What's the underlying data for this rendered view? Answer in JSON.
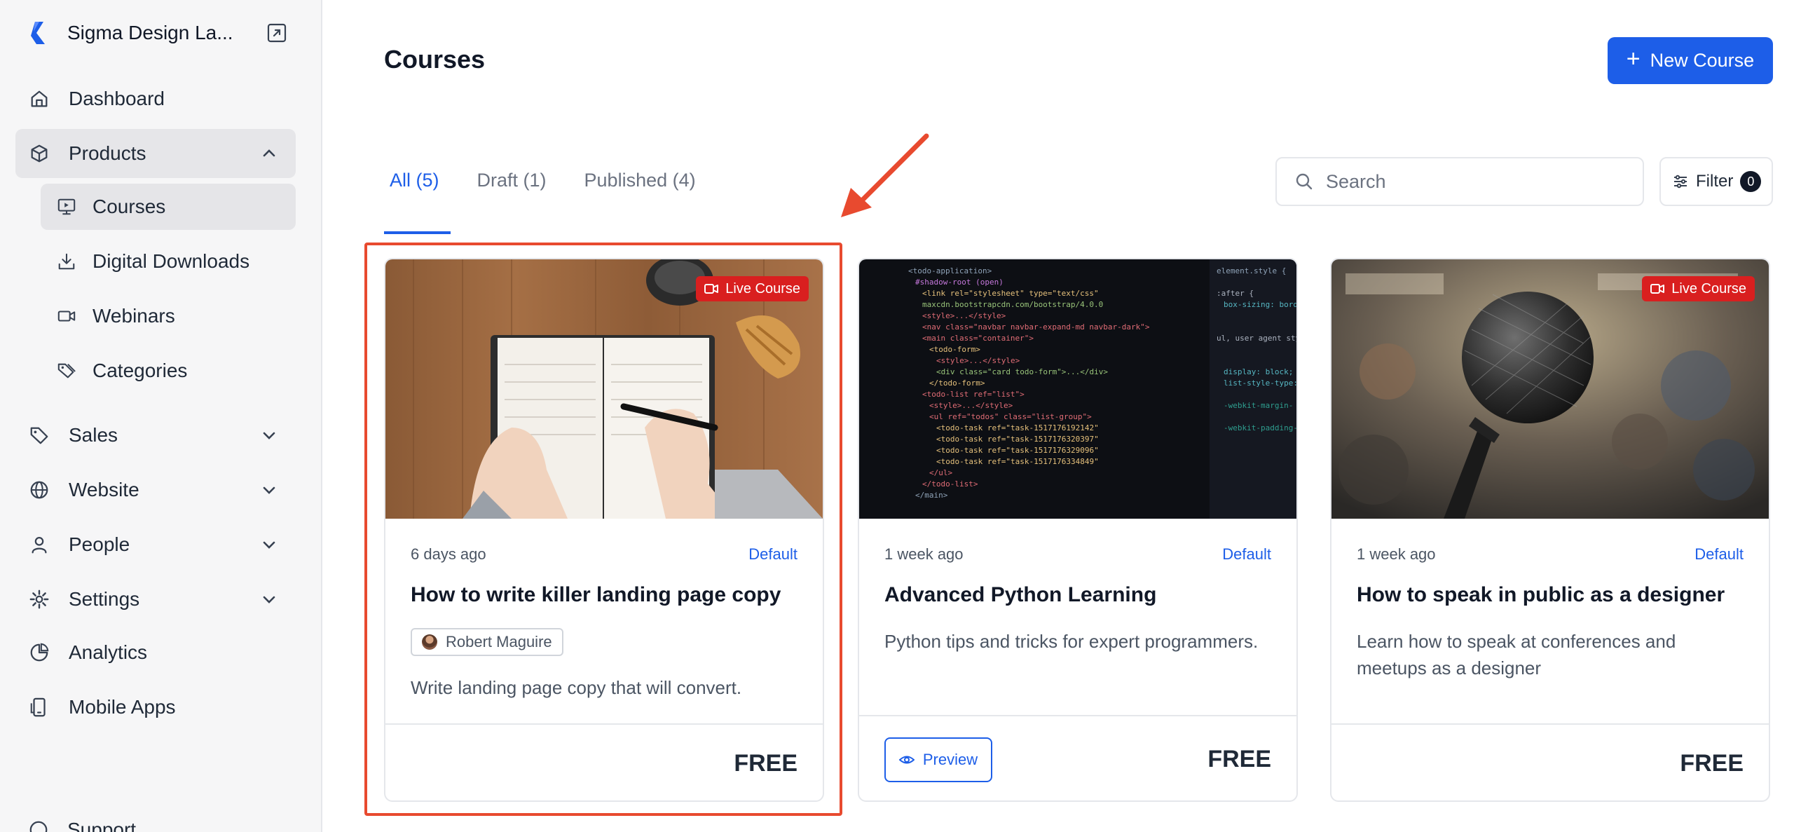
{
  "sidebar": {
    "brand_name": "Sigma Design La...",
    "items": [
      {
        "label": "Dashboard"
      },
      {
        "label": "Products"
      },
      {
        "label": "Sales"
      },
      {
        "label": "Website"
      },
      {
        "label": "People"
      },
      {
        "label": "Settings"
      },
      {
        "label": "Analytics"
      },
      {
        "label": "Mobile Apps"
      },
      {
        "label": "Support"
      }
    ],
    "products_sub": [
      {
        "label": "Courses"
      },
      {
        "label": "Digital Downloads"
      },
      {
        "label": "Webinars"
      },
      {
        "label": "Categories"
      }
    ]
  },
  "header": {
    "title": "Courses",
    "new_button": "New Course"
  },
  "tabs": [
    {
      "label": "All (5)"
    },
    {
      "label": "Draft (1)"
    },
    {
      "label": "Published (4)"
    }
  ],
  "search": {
    "placeholder": "Search"
  },
  "filter": {
    "label": "Filter",
    "count": "0"
  },
  "cards": [
    {
      "badge": "Live Course",
      "time": "6 days ago",
      "tag": "Default",
      "title": "How to write killer landing page copy",
      "author": "Robert Maguire",
      "description": "Write landing page copy that will convert.",
      "price": "FREE"
    },
    {
      "time": "1 week ago",
      "tag": "Default",
      "title": "Advanced Python Learning",
      "description": "Python tips and tricks for expert programmers.",
      "preview_label": "Preview",
      "price": "FREE"
    },
    {
      "badge": "Live Course",
      "time": "1 week ago",
      "tag": "Default",
      "title": "How to speak in public as a designer",
      "description": "Learn how to speak at conferences and meetups as a designer",
      "price": "FREE"
    }
  ],
  "colors": {
    "accent": "#1d5ee8",
    "live_badge": "#d91f1f",
    "highlight": "#e84a2f"
  }
}
